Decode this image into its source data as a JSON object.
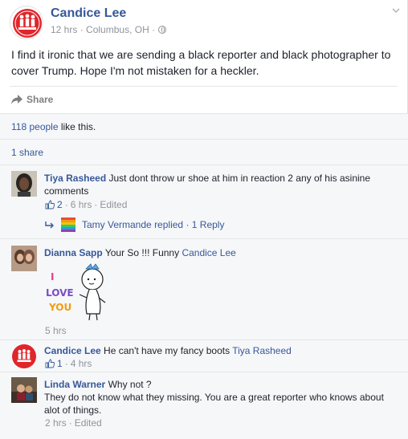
{
  "post": {
    "author": "Candice Lee",
    "time": "12 hrs",
    "location": "Columbus, OH",
    "separator": "·",
    "text": "I find it ironic that we are sending a black reporter and black photographer to cover Trump. Hope I'm not mistaken for a heckler.",
    "share_label": "Share",
    "likes_count": "118 people",
    "likes_suffix": "like this.",
    "shares": "1 share"
  },
  "comments": [
    {
      "author": "Tiya Rasheed",
      "text": "Just dont throw ur shoe at him in reaction 2 any of his asinine comments",
      "likes": "2",
      "time": "6 hrs",
      "edited": "Edited",
      "reply": {
        "author": "Tamy Vermande",
        "action": "replied",
        "count": "1 Reply"
      }
    },
    {
      "author": "Dianna Sapp",
      "text": "Your So !!! Funny",
      "mention": "Candice Lee",
      "sticker_text": [
        "I",
        "LOVE",
        "YOU"
      ],
      "time": "5 hrs"
    },
    {
      "author": "Candice Lee",
      "text": "He can't have my fancy boots",
      "mention": "Tiya Rasheed",
      "likes": "1",
      "time": "4 hrs"
    },
    {
      "author": "Linda Warner",
      "text": "Why not ?",
      "text2": "They do not know what they missing. You are a great reporter who knows about alot of things.",
      "time": "2 hrs",
      "edited": "Edited"
    }
  ],
  "colors": {
    "link": "#365899",
    "muted": "#90949c",
    "logo_red": "#e0252b"
  },
  "icons": [
    "chevron-down-icon",
    "globe-icon",
    "share-arrow-icon",
    "thumbs-up-icon",
    "reply-arrow-icon"
  ]
}
